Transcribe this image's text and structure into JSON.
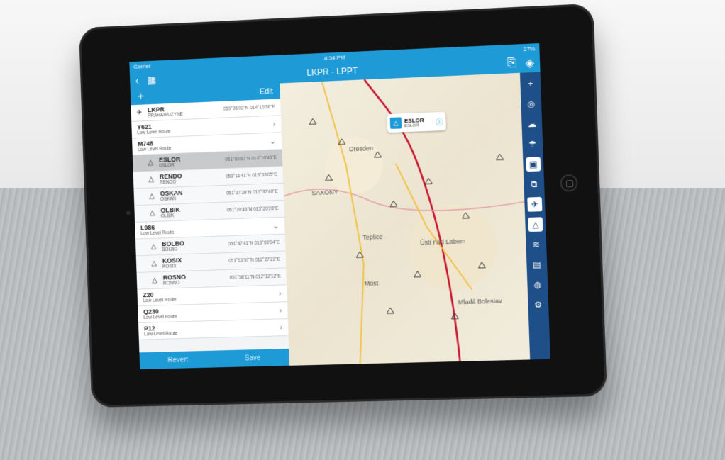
{
  "status": {
    "carrier": "Carrier",
    "time": "4:34 PM",
    "battery": "27%"
  },
  "nav": {
    "title": "LKPR - LPPT",
    "back_icon": "chevron-left-icon",
    "map_icon": "map-icon"
  },
  "panel": {
    "edit_label": "Edit",
    "add_icon": "plus-icon",
    "revert_label": "Revert",
    "save_label": "Save"
  },
  "rows": [
    {
      "kind": "wp",
      "name": "LKPR",
      "subname": "PRAHA/RUZYNE",
      "coord": "050°06'03\"N 014°15'36\"E"
    },
    {
      "kind": "route",
      "name": "Y621",
      "subname": "Low Level Route",
      "chev": "›"
    },
    {
      "kind": "route",
      "name": "M748",
      "subname": "Low Level Route",
      "chev": "⌄"
    },
    {
      "kind": "sub",
      "name": "ESLOR",
      "subname": "ESLOR",
      "coord": "051°03'57\"N 014°10'46\"E",
      "selected": true
    },
    {
      "kind": "sub",
      "name": "RENDO",
      "subname": "RENDO",
      "coord": "051°16'41\"N 013°53'05\"E"
    },
    {
      "kind": "sub",
      "name": "OSKAN",
      "subname": "OSKAN",
      "coord": "051°27'39\"N 013°37'40\"E"
    },
    {
      "kind": "sub",
      "name": "OLBIK",
      "subname": "OLBIK",
      "coord": "051°39'45\"N 013°20'28\"E"
    },
    {
      "kind": "route",
      "name": "L986",
      "subname": "Low Level Route",
      "chev": "⌄"
    },
    {
      "kind": "sub",
      "name": "BOLBO",
      "subname": "BOLBO",
      "coord": "051°47'41\"N 013°09'04\"E"
    },
    {
      "kind": "sub",
      "name": "KOSIX",
      "subname": "KOSIX",
      "coord": "051°53'57\"N 012°27'22\"E"
    },
    {
      "kind": "sub",
      "name": "ROSNO",
      "subname": "ROSNO",
      "coord": "051°58'11\"N 012°12'12\"E"
    },
    {
      "kind": "route",
      "name": "Z20",
      "subname": "Low Level Route",
      "chev": "›"
    },
    {
      "kind": "route",
      "name": "Q230",
      "subname": "Low Level Route",
      "chev": "›"
    },
    {
      "kind": "route",
      "name": "P12",
      "subname": "Low Level Route",
      "chev": "›"
    }
  ],
  "callout": {
    "name": "ESLOR",
    "sub": "ESLOR",
    "info_icon": "info-icon"
  },
  "map_labels": [
    "Dresden",
    "SAXONY",
    "Teplice",
    "Ústí nad Labem",
    "Most",
    "Mladá Boleslav"
  ],
  "toolbar_icons": [
    "plus-icon",
    "globe-icon",
    "cloud-icon",
    "weather-icon",
    "frame-icon",
    "layers-icon",
    "airport-icon",
    "navaid-icon",
    "wind-icon",
    "fir-icon",
    "compass-icon",
    "settings-icon"
  ],
  "colors": {
    "accent": "#1e9ad6",
    "toolbar": "#1e4f88",
    "route": "#c8102e"
  }
}
